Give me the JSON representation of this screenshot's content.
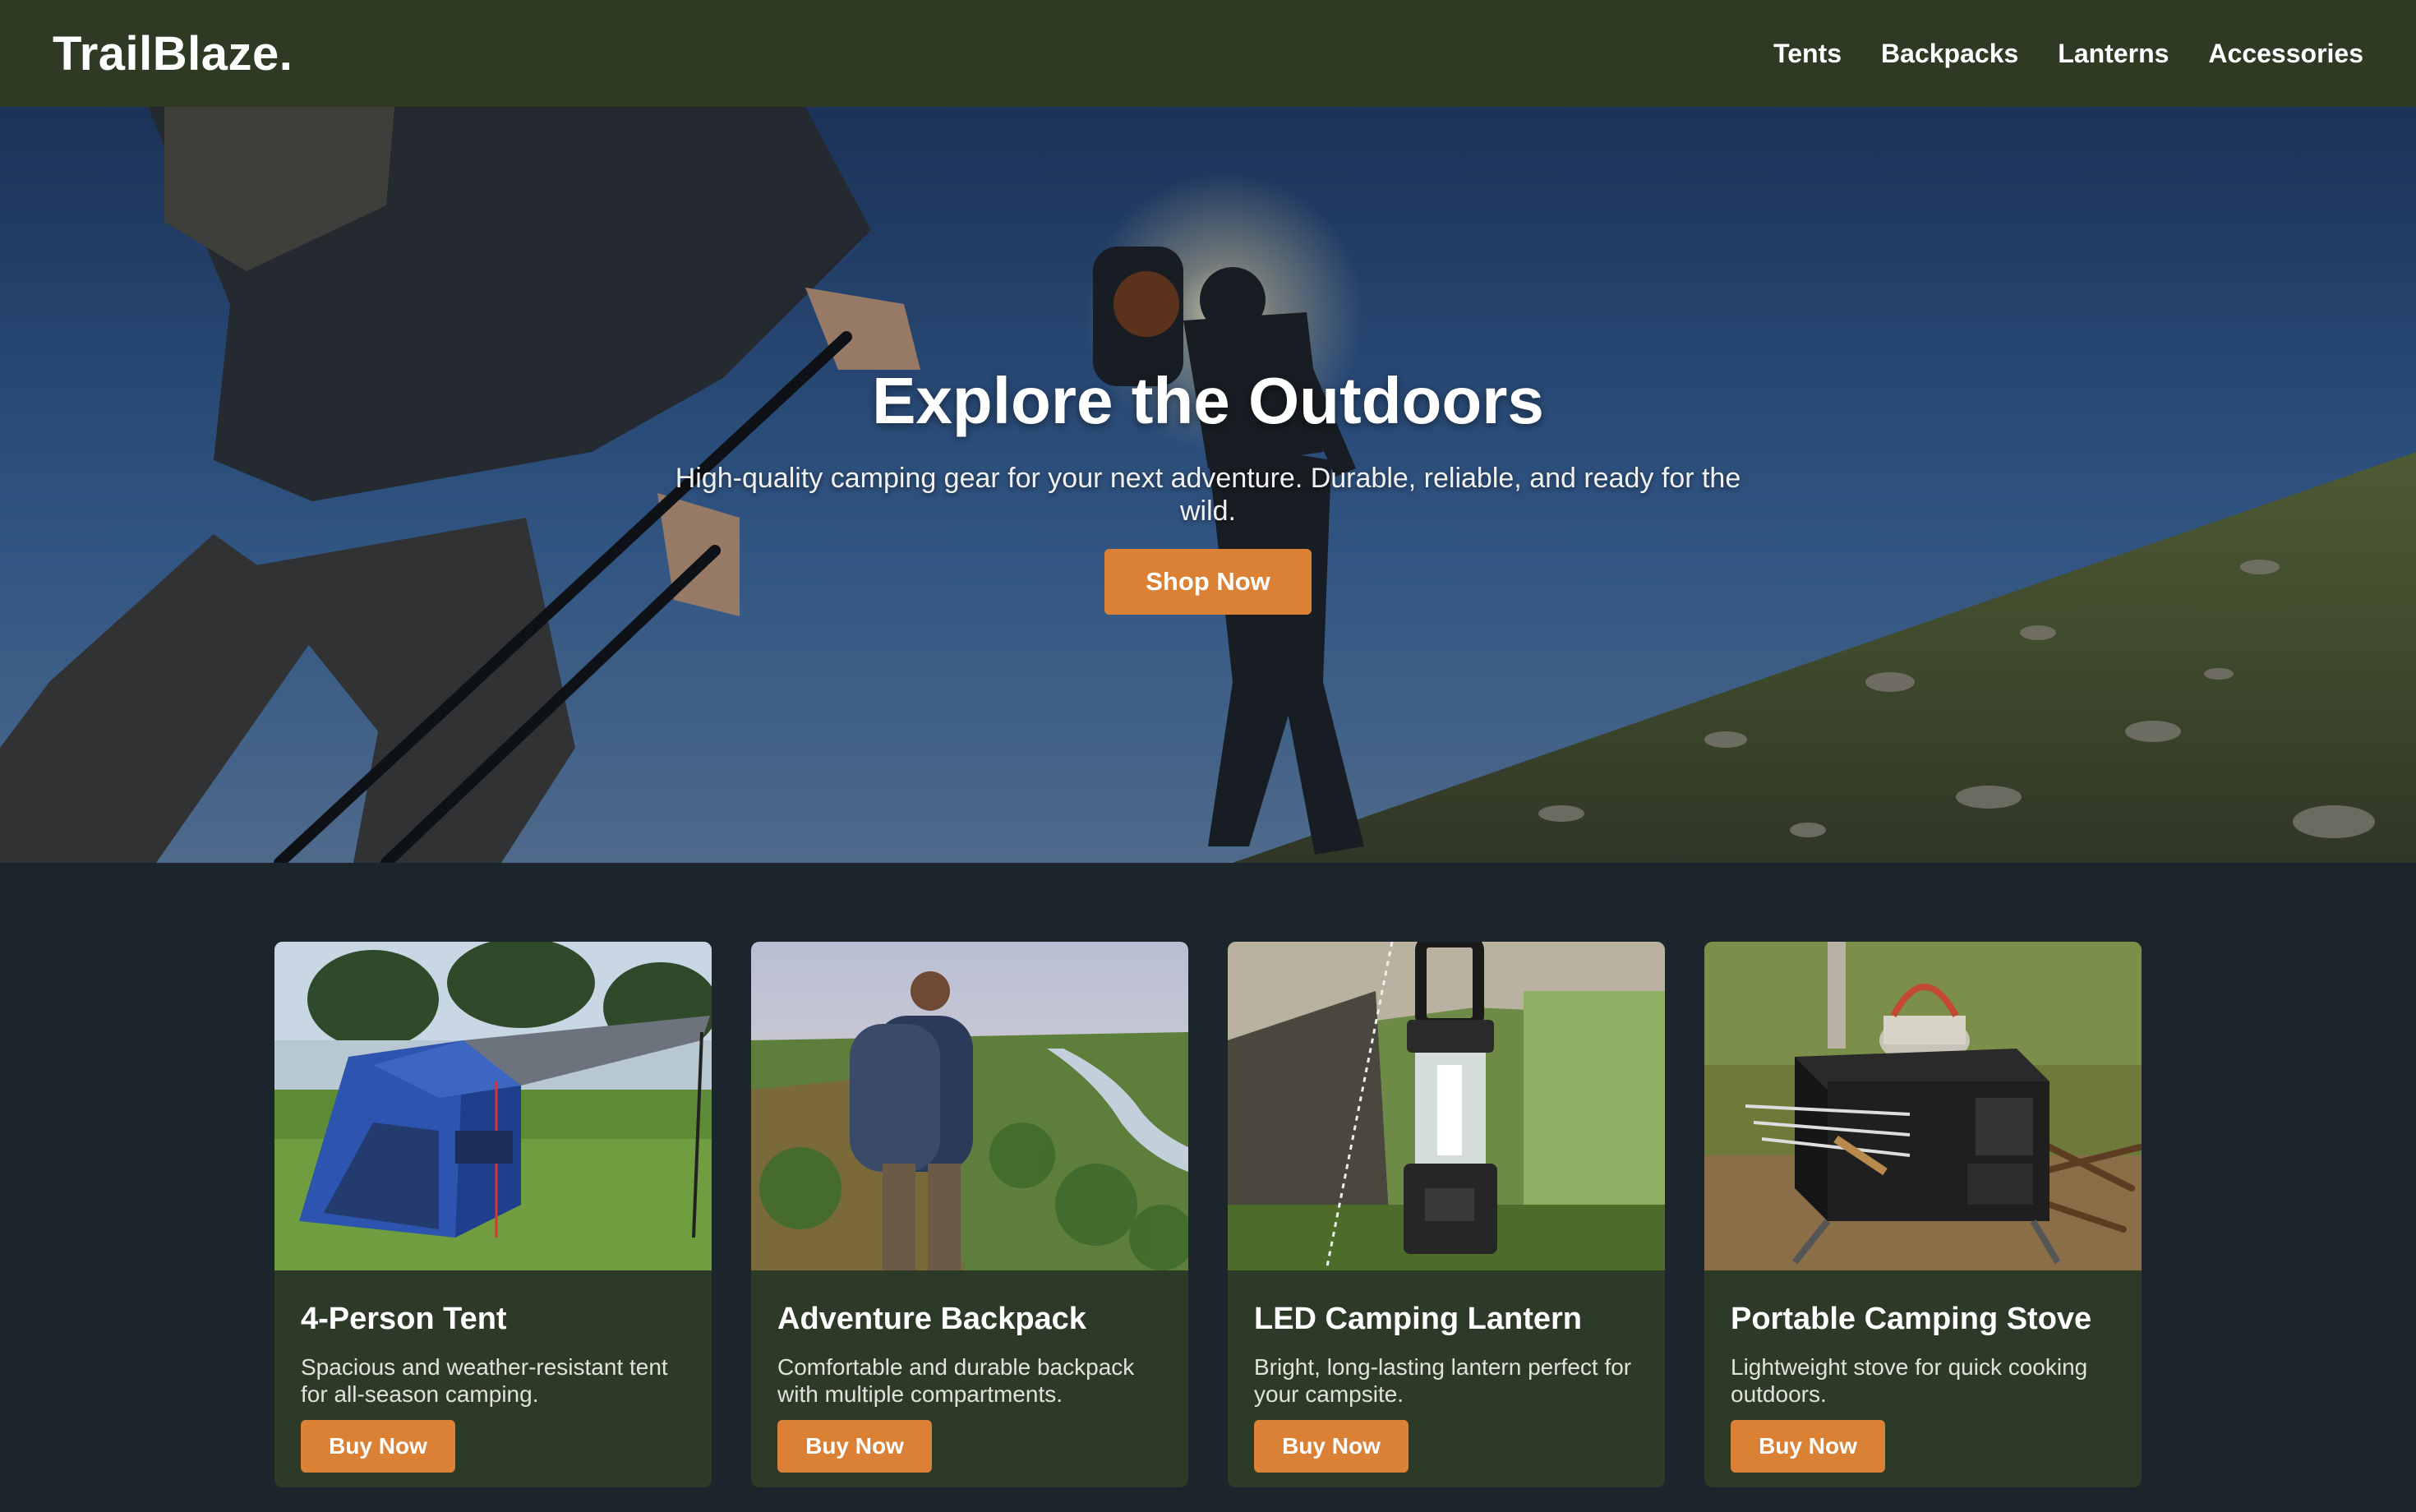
{
  "header": {
    "logo": "TrailBlaze.",
    "nav": [
      "Tents",
      "Backpacks",
      "Lanterns",
      "Accessories"
    ]
  },
  "hero": {
    "title": "Explore the Outdoors",
    "subtitle": "High-quality camping gear for your next adventure. Durable, reliable, and ready for the wild.",
    "button": "Shop Now"
  },
  "products": [
    {
      "title": "4-Person Tent",
      "description": "Spacious and weather-resistant tent for all-season camping.",
      "button": "Buy Now",
      "image": "tent-photo"
    },
    {
      "title": "Adventure Backpack",
      "description": "Comfortable and durable backpack with multiple compartments.",
      "button": "Buy Now",
      "image": "backpack-photo"
    },
    {
      "title": "LED Camping Lantern",
      "description": "Bright, long-lasting lantern perfect for your campsite.",
      "button": "Buy Now",
      "image": "lantern-photo"
    },
    {
      "title": "Portable Camping Stove",
      "description": "Lightweight stove for quick cooking outdoors.",
      "button": "Buy Now",
      "image": "stove-photo"
    }
  ],
  "colors": {
    "header_bg": "#2e3a23",
    "page_bg": "#1c242c",
    "card_bg": "#2e3a28",
    "accent": "#db8136"
  }
}
